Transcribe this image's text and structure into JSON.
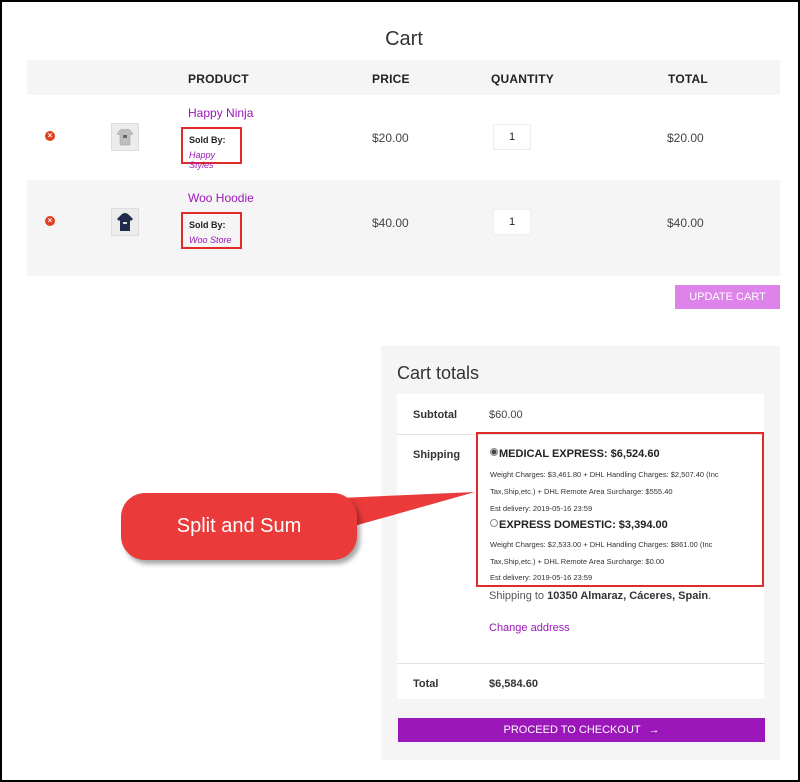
{
  "cart": {
    "title": "Cart",
    "headers": {
      "product": "PRODUCT",
      "price": "PRICE",
      "quantity": "QUANTITY",
      "total": "TOTAL"
    },
    "items": [
      {
        "name": "Happy Ninja",
        "sold_by_label": "Sold By:",
        "store": "Happy Styles",
        "price": "$20.00",
        "quantity": "1",
        "total": "$20.00",
        "thumb_icon": "tshirt-icon"
      },
      {
        "name": "Woo Hoodie",
        "sold_by_label": "Sold By:",
        "store": "Woo Store",
        "price": "$40.00",
        "quantity": "1",
        "total": "$40.00",
        "thumb_icon": "hoodie-icon"
      }
    ],
    "update_button": "UPDATE CART"
  },
  "totals": {
    "title": "Cart totals",
    "subtotal_label": "Subtotal",
    "subtotal_value": "$60.00",
    "shipping_label": "Shipping",
    "options": [
      {
        "label": "MEDICAL EXPRESS: $6,524.60",
        "selected": true,
        "line1": "Weight Charges: $3,461.80 + DHL Handling Charges: $2,507.40 (Inc",
        "line2": "Tax,Ship,etc.) + DHL Remote Area Surcharge: $555.40",
        "est": "Est delivery: 2019-05-16 23:59"
      },
      {
        "label": "EXPRESS DOMESTIC: $3,394.00",
        "selected": false,
        "line1": "Weight Charges: $2,533.00 + DHL Handling Charges: $861.00 (Inc",
        "line2": "Tax,Ship,etc.) + DHL Remote Area Surcharge: $0.00",
        "est": "Est delivery: 2019-05-16 23:59"
      }
    ],
    "shipping_to_prefix": "Shipping to ",
    "shipping_to_address": "10350 Almaraz, Cáceres, Spain",
    "shipping_to_suffix": ".",
    "change_address": "Change address",
    "total_label": "Total",
    "total_value": "$6,584.60",
    "checkout_button": "PROCEED TO CHECKOUT",
    "checkout_arrow": "→"
  },
  "callout": {
    "text": "Split and Sum"
  },
  "colors": {
    "accent": "#9b17b9",
    "update_button": "#dd83e9",
    "highlight_box": "#e02b2b",
    "callout": "#ea3a3a",
    "remove": "#e2401c"
  }
}
